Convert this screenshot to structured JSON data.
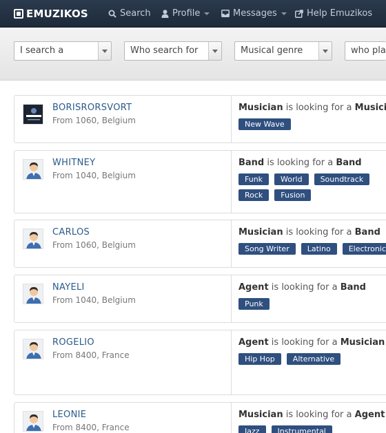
{
  "nav": {
    "brand": "EMUZIKOS",
    "search": "Search",
    "profile": "Profile",
    "messages": "Messages",
    "help": "Help Emuzikos"
  },
  "filters": {
    "i_search": "I search a",
    "who_search": "Who search for",
    "genre": "Musical genre",
    "who_plays": "who plays"
  },
  "results": [
    {
      "name": "BORISRORSVORT",
      "location": "From 1060, Belgium",
      "role": "Musician",
      "looking_text": "is looking for a",
      "target": "Musician",
      "tags": [
        "New Wave"
      ]
    },
    {
      "name": "WHITNEY",
      "location": "From 1040, Belgium",
      "role": "Band",
      "looking_text": "is looking for a",
      "target": "Band",
      "tags": [
        "Funk",
        "World",
        "Soundtrack",
        "Rock",
        "Fusion"
      ]
    },
    {
      "name": "CARLOS",
      "location": "From 1060, Belgium",
      "role": "Musician",
      "looking_text": "is looking for a",
      "target": "Band",
      "tags": [
        "Song Writer",
        "Latino",
        "Electronic"
      ]
    },
    {
      "name": "NAYELI",
      "location": "From 1040, Belgium",
      "role": "Agent",
      "looking_text": "is looking for a",
      "target": "Band",
      "tags": [
        "Punk"
      ]
    },
    {
      "name": "ROGELIO",
      "location": "From 8400, France",
      "role": "Agent",
      "looking_text": "is looking for a",
      "target": "Musician",
      "tags": [
        "Hip Hop",
        "Alternative"
      ]
    },
    {
      "name": "LEONIE",
      "location": "From 8400, France",
      "role": "Musician",
      "looking_text": "is looking for a",
      "target": "Agent",
      "tags": [
        "Jazz",
        "Instrumental"
      ]
    }
  ]
}
